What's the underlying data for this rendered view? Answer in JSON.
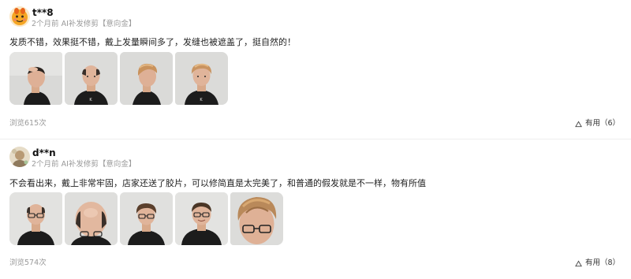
{
  "reviews": [
    {
      "username": "t**8",
      "time": "2个月前",
      "variant": "AI补发修剪",
      "tag": "【意向金】",
      "text": "发质不错，效果挺不错，戴上发量瞬间多了，发缝也被遮盖了，挺自然的！",
      "photo_count": 4,
      "views_label": "浏览615次",
      "useful_label": "有用（6）"
    },
    {
      "username": "d**n",
      "time": "2个月前",
      "variant": "AI补发修剪",
      "tag": "【意向金】",
      "text": "不会看出来，戴上非常牢固，店家还送了胶片，可以修简直是太完美了，和普通的假发就是不一样，物有所值",
      "photo_count": 5,
      "views_label": "浏览574次",
      "useful_label": "有用（8）"
    }
  ],
  "colors": {
    "meta_text": "#9a9a9a",
    "body_text": "#222222",
    "divider": "#eeeeee",
    "avatar_1_bg": "#f5a623",
    "avatar_2_bg": "#d8c7a6"
  }
}
